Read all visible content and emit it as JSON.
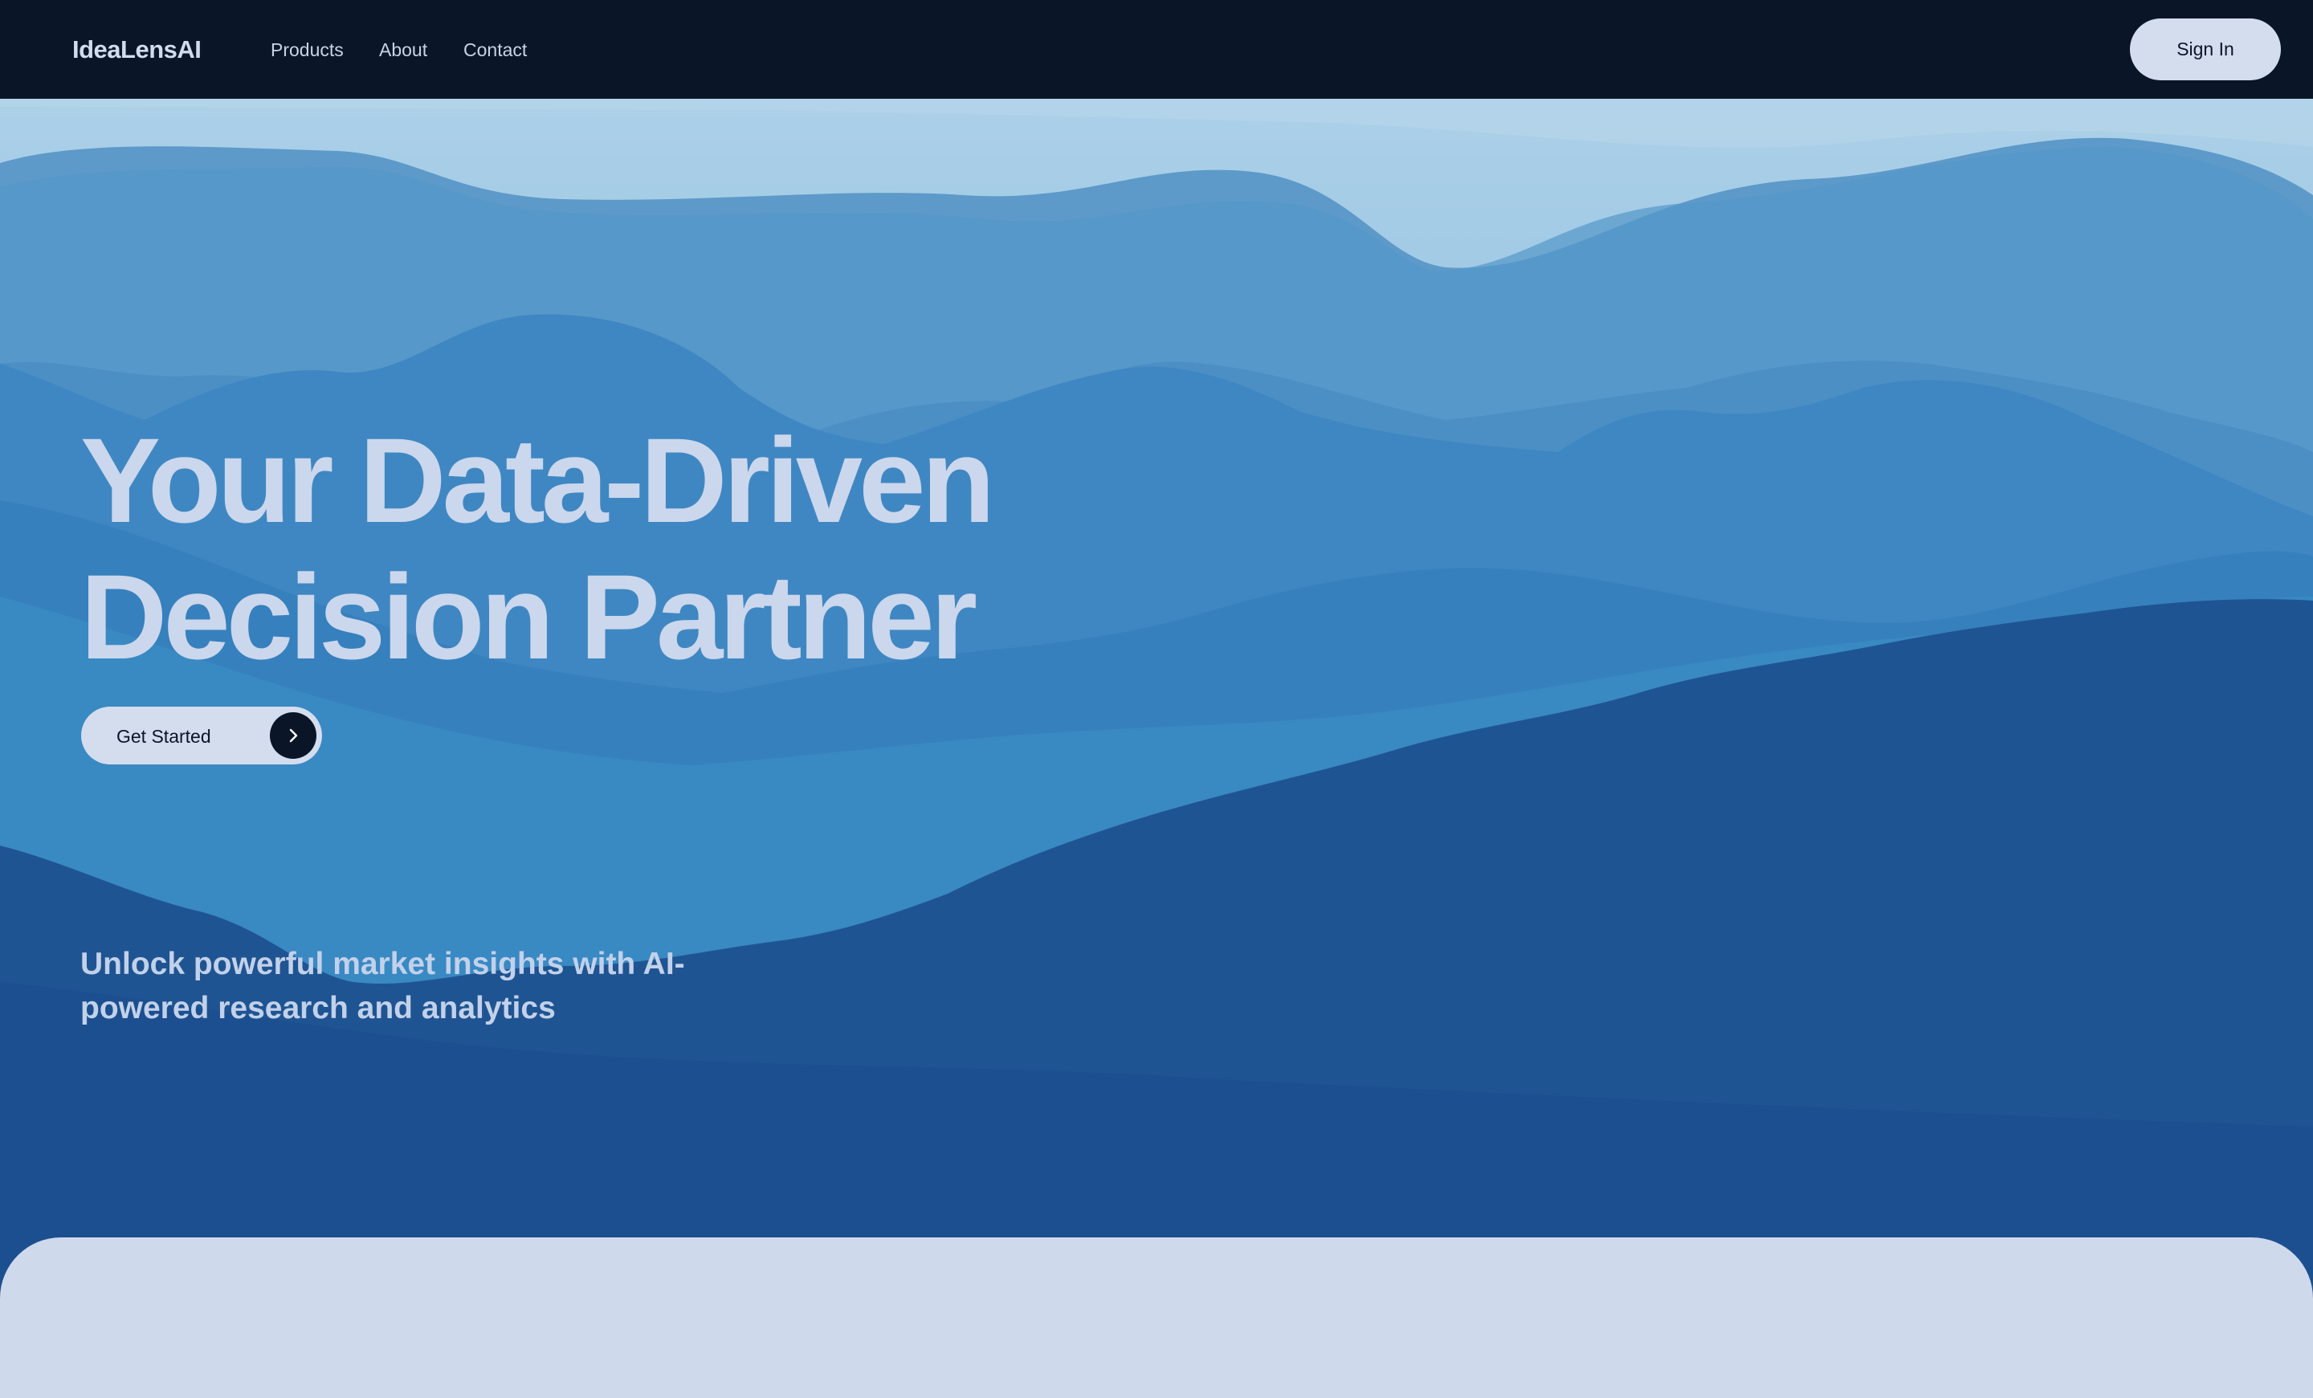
{
  "header": {
    "logo": "IdeaLensAI",
    "nav": {
      "products": "Products",
      "about": "About",
      "contact": "Contact"
    },
    "sign_in": "Sign In"
  },
  "hero": {
    "headline_line1": "Your Data-Driven",
    "headline_line2": "Decision Partner",
    "cta_label": "Get Started",
    "cta_icon": "chevron-right-icon",
    "subtext": "Unlock powerful market insights with AI-powered research and analytics"
  },
  "colors": {
    "header_bg": "#0a1628",
    "pill_bg": "#d4ddee",
    "headline": "#cbd7ec",
    "foreground_ridge": "#1d4f8f",
    "panel_bg": "#cfd9ec"
  }
}
